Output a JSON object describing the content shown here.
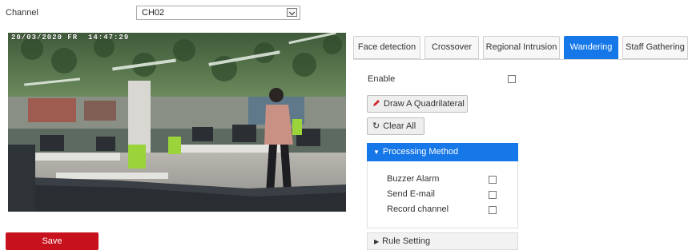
{
  "channel": {
    "label": "Channel",
    "selected": "CH02"
  },
  "video": {
    "osd_text": "20/03/2020 FR  14:47:29"
  },
  "save_label": "Save",
  "tabs": [
    {
      "label": "Face detection",
      "active": false
    },
    {
      "label": "Crossover",
      "active": false
    },
    {
      "label": "Regional Intrusion",
      "active": false
    },
    {
      "label": "Wandering",
      "active": true
    },
    {
      "label": "Staff Gathering",
      "active": false
    }
  ],
  "panel": {
    "enable_label": "Enable",
    "enable_checked": false,
    "draw_label": "Draw A Quadrilateral",
    "clear_label": "Clear All",
    "processing_label": "Processing Method",
    "processing_options": [
      {
        "label": "Buzzer Alarm",
        "checked": false
      },
      {
        "label": "Send E-mail",
        "checked": false
      },
      {
        "label": "Record channel",
        "checked": false
      }
    ],
    "rule_label": "Rule Setting"
  },
  "colors": {
    "accent": "#1677e8",
    "save_button": "#c7121d"
  }
}
